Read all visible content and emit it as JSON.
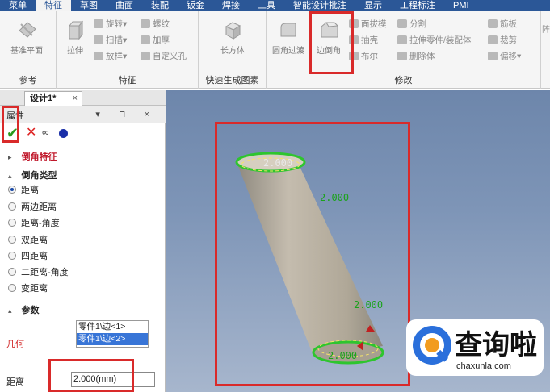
{
  "menu": [
    "菜单",
    "特征",
    "草图",
    "曲面",
    "装配",
    "钣金",
    "焊接",
    "工具",
    "智能设计批注",
    "显示",
    "工程标注",
    "PMI"
  ],
  "ribbon": {
    "ref": {
      "label": "参考",
      "base_plane": "基准平面"
    },
    "feature": {
      "label": "特征",
      "extrude": "拉伸",
      "revolve": "旋转",
      "sweep": "扫描",
      "loft": "放样",
      "thread": "螺纹",
      "thicken": "加厚",
      "custom_hole": "自定义孔"
    },
    "quick": {
      "label": "快速生成图素",
      "cuboid": "长方体"
    },
    "modify": {
      "label": "修改",
      "fillet": "圆角过渡",
      "chamfer": "边倒角",
      "draft": "面拔模",
      "shell": "抽壳",
      "boolean": "布尔",
      "split": "分割",
      "extrude_part": "拉伸零件/装配体",
      "delete_body": "删除体",
      "rib": "筋板",
      "trim": "裁剪",
      "offset": "偏移"
    },
    "more": "阵"
  },
  "tab": {
    "label": "设计1*",
    "close": "×"
  },
  "panel": {
    "title": "属性",
    "controls": "▾ ⊓ ×",
    "chamfer_feature": "倒角特征",
    "chamfer_type": "倒角类型",
    "options": [
      "距离",
      "两边距离",
      "距离-角度",
      "双距离",
      "四距离",
      "二距离-角度",
      "变距离"
    ],
    "selected_option": "距离",
    "params": "参数",
    "geometry_label": "几何",
    "geometry_items": [
      "零件1\\边<1>",
      "零件1\\边<2>"
    ],
    "selected_geometry": "零件1\\边<2>",
    "distance_label": "距离",
    "distance_value": "2.000(mm)"
  },
  "viewport": {
    "dim_labels": [
      "2.000",
      "2.000",
      "2.000",
      "2.000"
    ]
  },
  "watermark": {
    "text": "查询啦",
    "url": "chaxunla.com"
  },
  "colors": {
    "menu_bg": "#2b5797",
    "highlight": "#d92a2a",
    "edge": "#2ec52e",
    "dim_text": "#1aa31a"
  }
}
